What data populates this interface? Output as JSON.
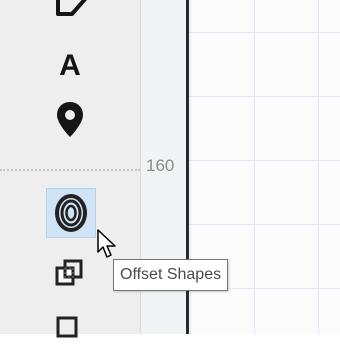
{
  "sidebar": {
    "tools": [
      {
        "name": "polygon-tool",
        "icon": "polygon-icon"
      },
      {
        "name": "text-tool",
        "icon": "text-icon",
        "glyph": "A"
      },
      {
        "name": "location-pin-tool",
        "icon": "location-pin-icon"
      },
      {
        "name": "offset-shapes-tool",
        "icon": "offset-shapes-icon",
        "selected": true
      },
      {
        "name": "combine-shapes-tool",
        "icon": "combine-shapes-icon"
      }
    ]
  },
  "canvas": {
    "ruler_label": "160"
  },
  "tooltip": {
    "text": "Offset Shapes"
  },
  "colors": {
    "sidebar_bg": "#eeeeee",
    "selected_bg": "#cfe3f4",
    "icon": "#151515",
    "grid_line": "#e4e7ed"
  }
}
